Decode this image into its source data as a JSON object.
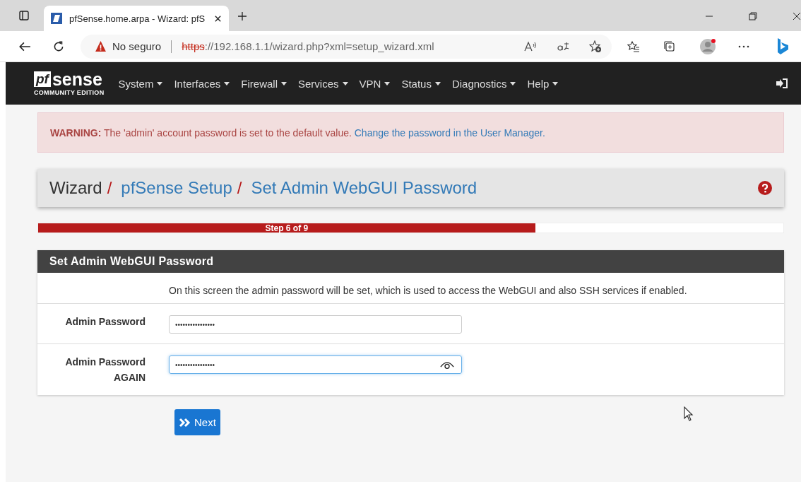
{
  "browser": {
    "tab_title": "pfSense.home.arpa - Wizard: pfS",
    "address": {
      "security": "No seguro",
      "scheme": "https",
      "rest": "://192.168.1.1/wizard.php?xml=setup_wizard.xml"
    }
  },
  "logo": {
    "mark": "pf",
    "word": "sense",
    "edition": "COMMUNITY EDITION"
  },
  "nav": [
    {
      "label": "System"
    },
    {
      "label": "Interfaces"
    },
    {
      "label": "Firewall"
    },
    {
      "label": "Services"
    },
    {
      "label": "VPN"
    },
    {
      "label": "Status"
    },
    {
      "label": "Diagnostics"
    },
    {
      "label": "Help"
    }
  ],
  "warning": {
    "label": "WARNING:",
    "text": "The 'admin' account password is set to the default value.",
    "link": "Change the password in the User Manager."
  },
  "breadcrumb": [
    {
      "label": "Wizard",
      "link": false
    },
    {
      "separator": "/",
      "label": "pfSense Setup",
      "link": true
    },
    {
      "separator": "/",
      "label": "Set Admin WebGUI Password",
      "link": true
    }
  ],
  "progress": {
    "label": "Step 6 of 9",
    "level": 0.667
  },
  "panel": {
    "title": "Set Admin WebGUI Password",
    "description": "On this screen the admin password will be set, which is used to access the WebGUI and also SSH services if enabled.",
    "fields": [
      {
        "label": "Admin Password",
        "value": "••••••••••••••••",
        "focused": false
      },
      {
        "label": "Admin Password AGAIN",
        "value": "••••••••••••••••",
        "focused": true
      }
    ]
  },
  "next_button": "Next"
}
